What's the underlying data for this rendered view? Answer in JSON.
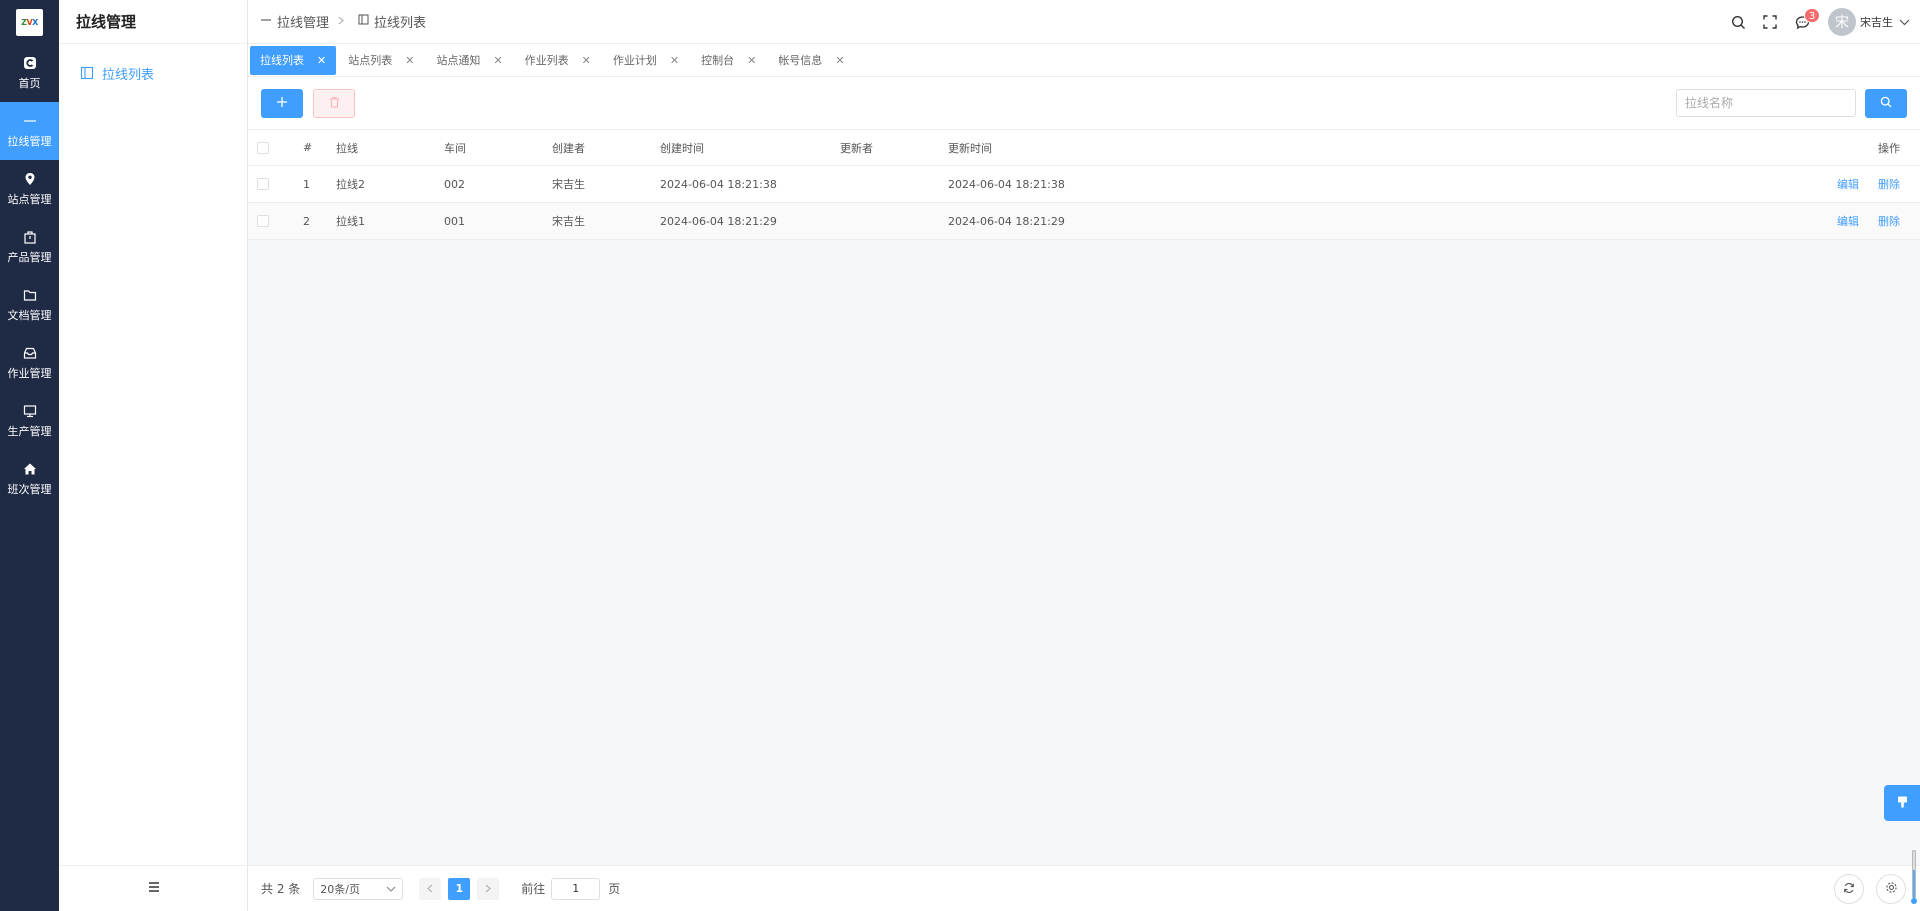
{
  "colors": {
    "primary": "#409eff",
    "rail_bg": "#1f2a44",
    "danger_light": "#fef0f0"
  },
  "logo": {
    "parts": [
      "Z",
      "V",
      "X"
    ]
  },
  "rail": {
    "items": [
      {
        "label": "首页",
        "icon": "home-c-icon"
      },
      {
        "label": "拉线管理",
        "icon": "line-icon"
      },
      {
        "label": "站点管理",
        "icon": "location-pin-icon"
      },
      {
        "label": "产品管理",
        "icon": "box-icon"
      },
      {
        "label": "文档管理",
        "icon": "folder-icon"
      },
      {
        "label": "作业管理",
        "icon": "inbox-icon"
      },
      {
        "label": "生产管理",
        "icon": "monitor-icon"
      },
      {
        "label": "班次管理",
        "icon": "house-icon"
      }
    ]
  },
  "submenu": {
    "title": "拉线管理",
    "items": [
      {
        "label": "拉线列表",
        "icon": "list-book-icon"
      }
    ],
    "collapse_icon": "hamburger-icon"
  },
  "breadcrumb": [
    {
      "label": "拉线管理",
      "icon": "line-icon"
    },
    {
      "label": "拉线列表",
      "icon": "list-book-icon"
    }
  ],
  "header": {
    "icons": [
      "search-icon",
      "fullscreen-icon",
      "message-icon"
    ],
    "message_badge": "3",
    "user": {
      "avatar_text": "宋",
      "name": "宋吉生"
    }
  },
  "tabs": [
    {
      "label": "拉线列表",
      "active": true
    },
    {
      "label": "站点列表"
    },
    {
      "label": "站点通知"
    },
    {
      "label": "作业列表"
    },
    {
      "label": "作业计划"
    },
    {
      "label": "控制台"
    },
    {
      "label": "帐号信息"
    }
  ],
  "toolbar": {
    "add_icon": "plus-icon",
    "delete_icon": "trash-icon",
    "search_placeholder": "拉线名称",
    "search_value": "",
    "search_icon": "search-icon"
  },
  "table": {
    "headers": {
      "num": "#",
      "line": "拉线",
      "shop": "车间",
      "creator": "创建者",
      "ctime": "创建时间",
      "updater": "更新者",
      "utime": "更新时间",
      "ops": "操作"
    },
    "rows": [
      {
        "num": "1",
        "line": "拉线2",
        "shop": "002",
        "creator": "宋吉生",
        "ctime": "2024-06-04 18:21:38",
        "updater": "",
        "utime": "2024-06-04 18:21:38",
        "edit": "编辑",
        "delete": "删除"
      },
      {
        "num": "2",
        "line": "拉线1",
        "shop": "001",
        "creator": "宋吉生",
        "ctime": "2024-06-04 18:21:29",
        "updater": "",
        "utime": "2024-06-04 18:21:29",
        "edit": "编辑",
        "delete": "删除"
      }
    ]
  },
  "pager": {
    "total": "共 2 条",
    "page_size": "20条/页",
    "current_page": "1",
    "goto_label": "前往",
    "goto_value": "1",
    "page_suffix": "页"
  }
}
